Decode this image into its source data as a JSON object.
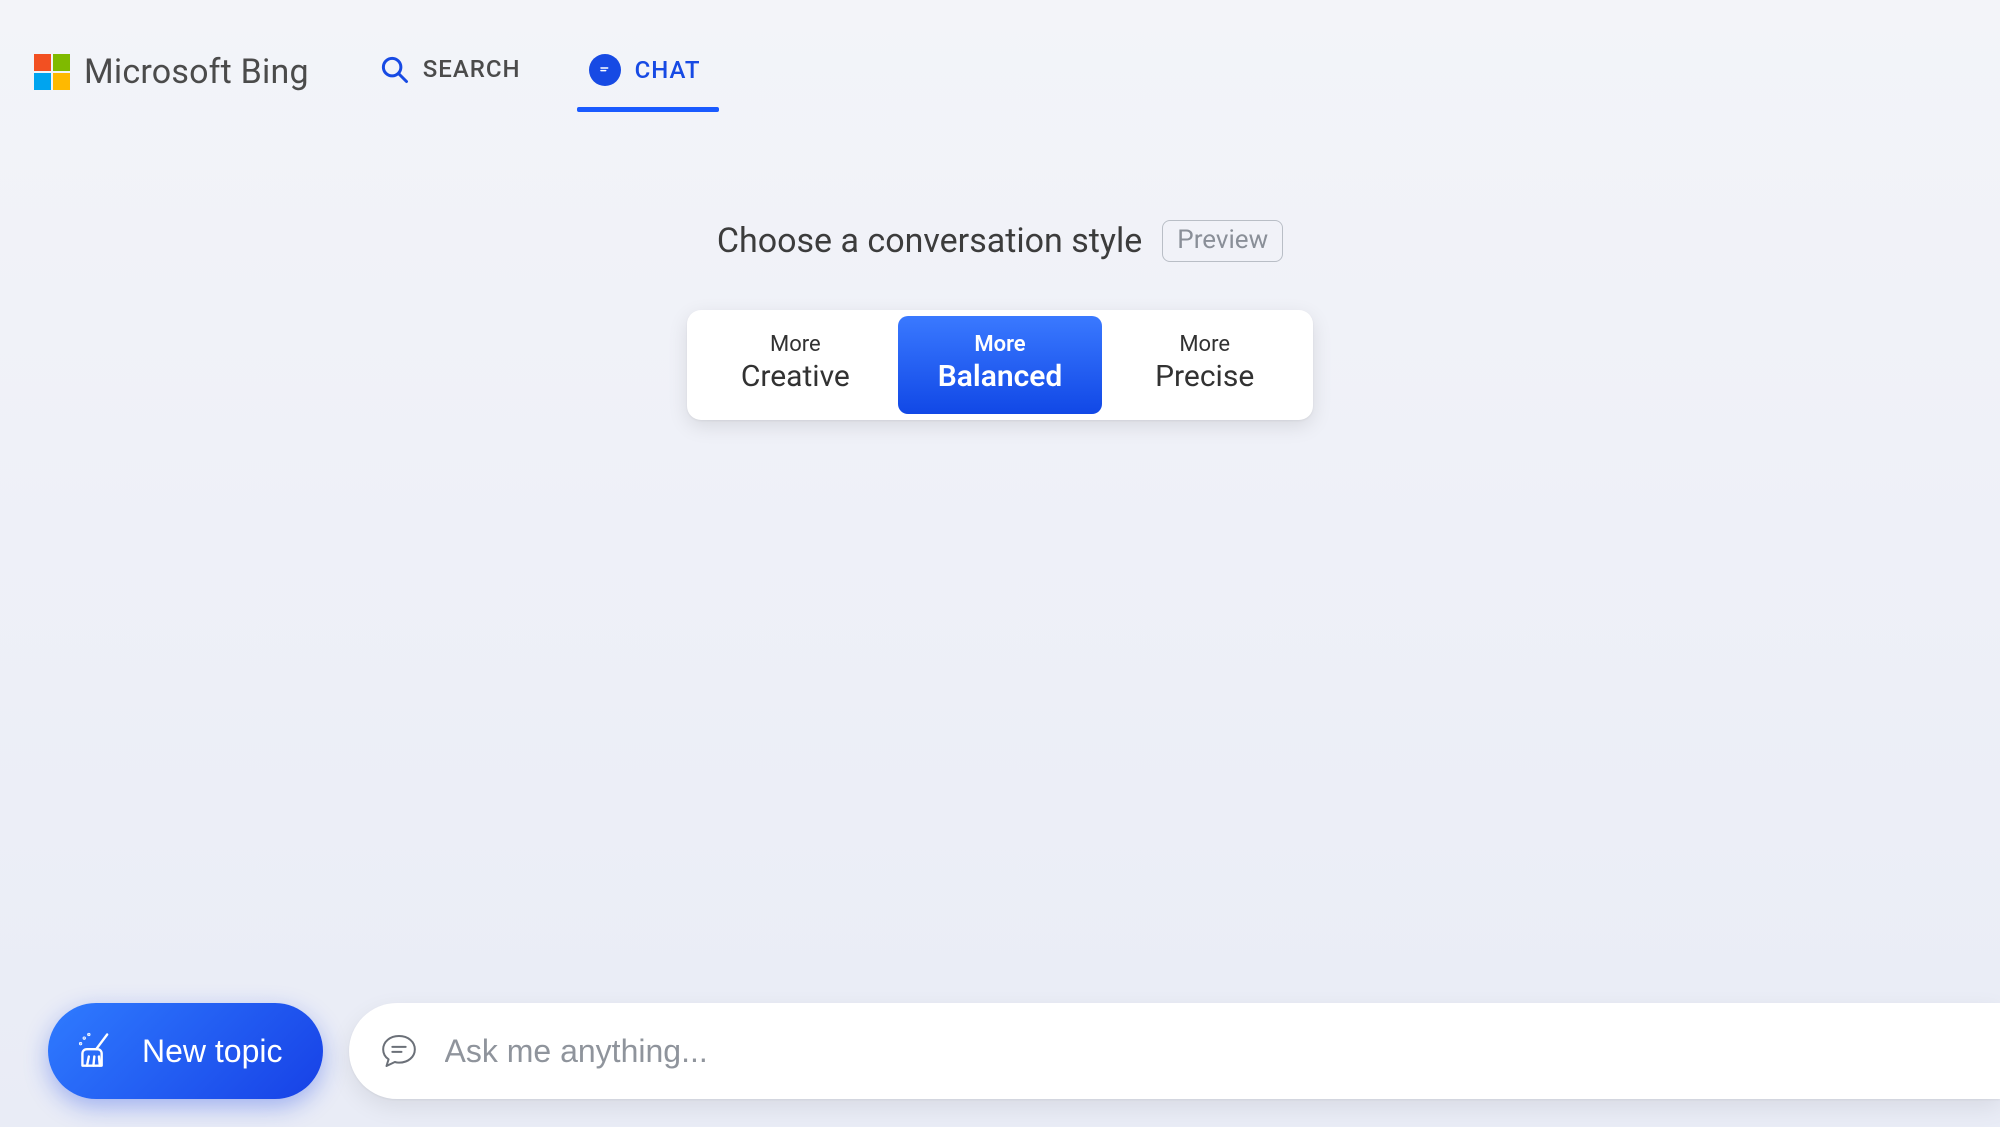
{
  "brand": {
    "name": "Microsoft Bing"
  },
  "nav": {
    "search_label": "SEARCH",
    "chat_label": "CHAT",
    "active": "chat"
  },
  "style_picker": {
    "heading": "Choose a conversation style",
    "badge": "Preview",
    "options": [
      {
        "line1": "More",
        "line2": "Creative",
        "active": false
      },
      {
        "line1": "More",
        "line2": "Balanced",
        "active": true
      },
      {
        "line1": "More",
        "line2": "Precise",
        "active": false
      }
    ]
  },
  "composer": {
    "new_topic_label": "New topic",
    "input_placeholder": "Ask me anything..."
  },
  "colors": {
    "accent": "#174ae4",
    "accent_gradient_start": "#3a79ff",
    "accent_gradient_end": "#1148e6"
  }
}
